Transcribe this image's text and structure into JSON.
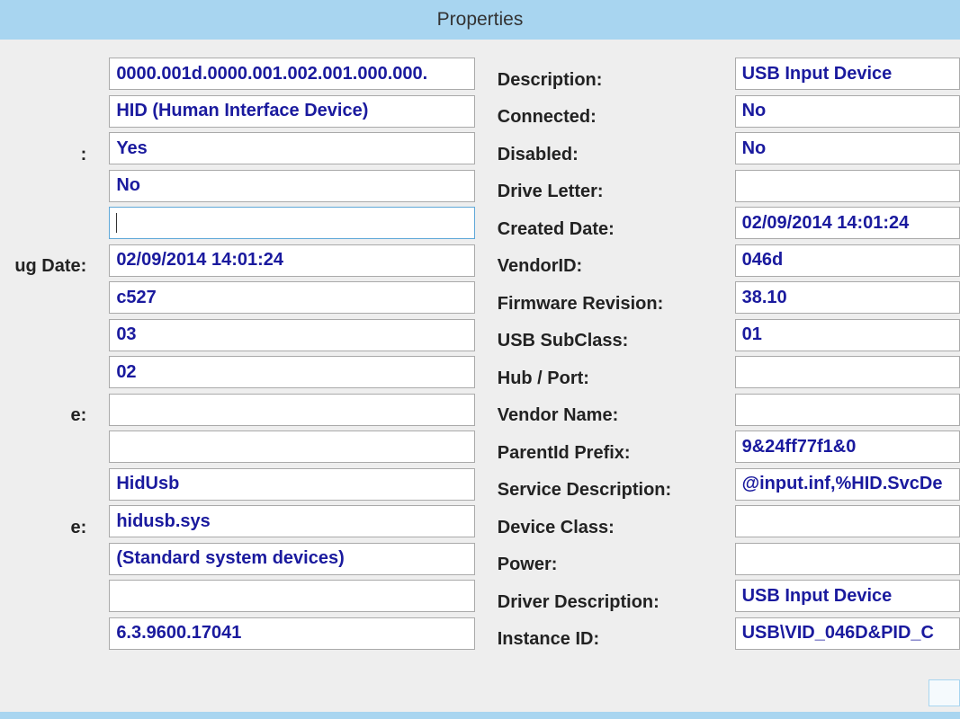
{
  "window": {
    "title": "Properties"
  },
  "leftLabels": [
    "",
    "",
    ":",
    "",
    "",
    "ug Date:",
    "",
    "",
    "",
    "e:",
    "",
    "",
    "e:",
    "",
    "",
    ""
  ],
  "leftValues": [
    "0000.001d.0000.001.002.001.000.000.",
    "HID (Human Interface Device)",
    "Yes",
    "No",
    "",
    "02/09/2014 14:01:24",
    "c527",
    "03",
    "02",
    "",
    "",
    "HidUsb",
    "hidusb.sys",
    "(Standard system devices)",
    "",
    "6.3.9600.17041"
  ],
  "rightLabels": [
    "Description:",
    "Connected:",
    "Disabled:",
    "Drive Letter:",
    "Created Date:",
    "VendorID:",
    "Firmware Revision:",
    "USB SubClass:",
    "Hub / Port:",
    "Vendor Name:",
    "ParentId Prefix:",
    "Service Description:",
    "Device Class:",
    "Power:",
    "Driver Description:",
    "Instance ID:"
  ],
  "rightValues": [
    "USB Input Device",
    "No",
    "No",
    "",
    "02/09/2014 14:01:24",
    "046d",
    "38.10",
    "01",
    "",
    "",
    "9&24ff77f1&0",
    "@input.inf,%HID.SvcDe",
    "",
    "",
    "USB Input Device",
    "USB\\VID_046D&PID_C"
  ]
}
